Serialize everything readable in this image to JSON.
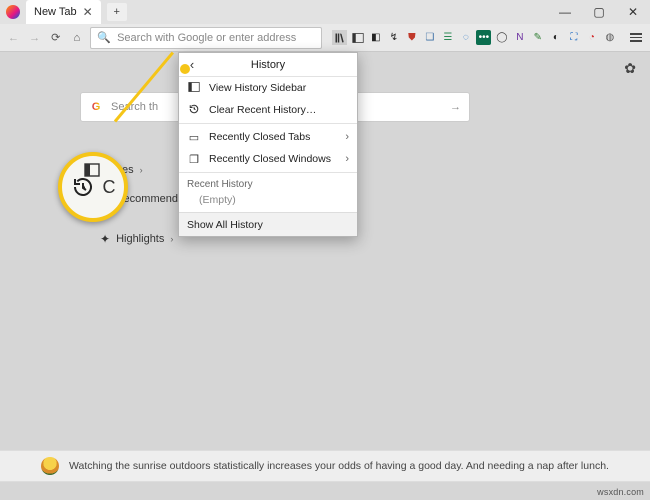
{
  "window": {
    "tab_title": "New Tab",
    "min": "—",
    "max": "▢",
    "close": "✕"
  },
  "toolbar": {
    "url_placeholder": "Search with Google or enter address"
  },
  "history_menu": {
    "title": "History",
    "items": {
      "view_sidebar": "View History Sidebar",
      "clear_recent": "Clear Recent History…",
      "recently_closed_tabs": "Recently Closed Tabs",
      "recently_closed_windows": "Recently Closed Windows"
    },
    "recent_heading": "Recent History",
    "recent_empty": "(Empty)",
    "show_all": "Show All History"
  },
  "page": {
    "search_placeholder": "Search th",
    "top_sites": "p Sites",
    "recommended": "Recommended b",
    "highlights": "Highlights"
  },
  "footer": {
    "message": "Watching the sunrise outdoors statistically increases your odds of having a good day. And needing a nap after lunch."
  },
  "watermark": "wsxdn.com"
}
